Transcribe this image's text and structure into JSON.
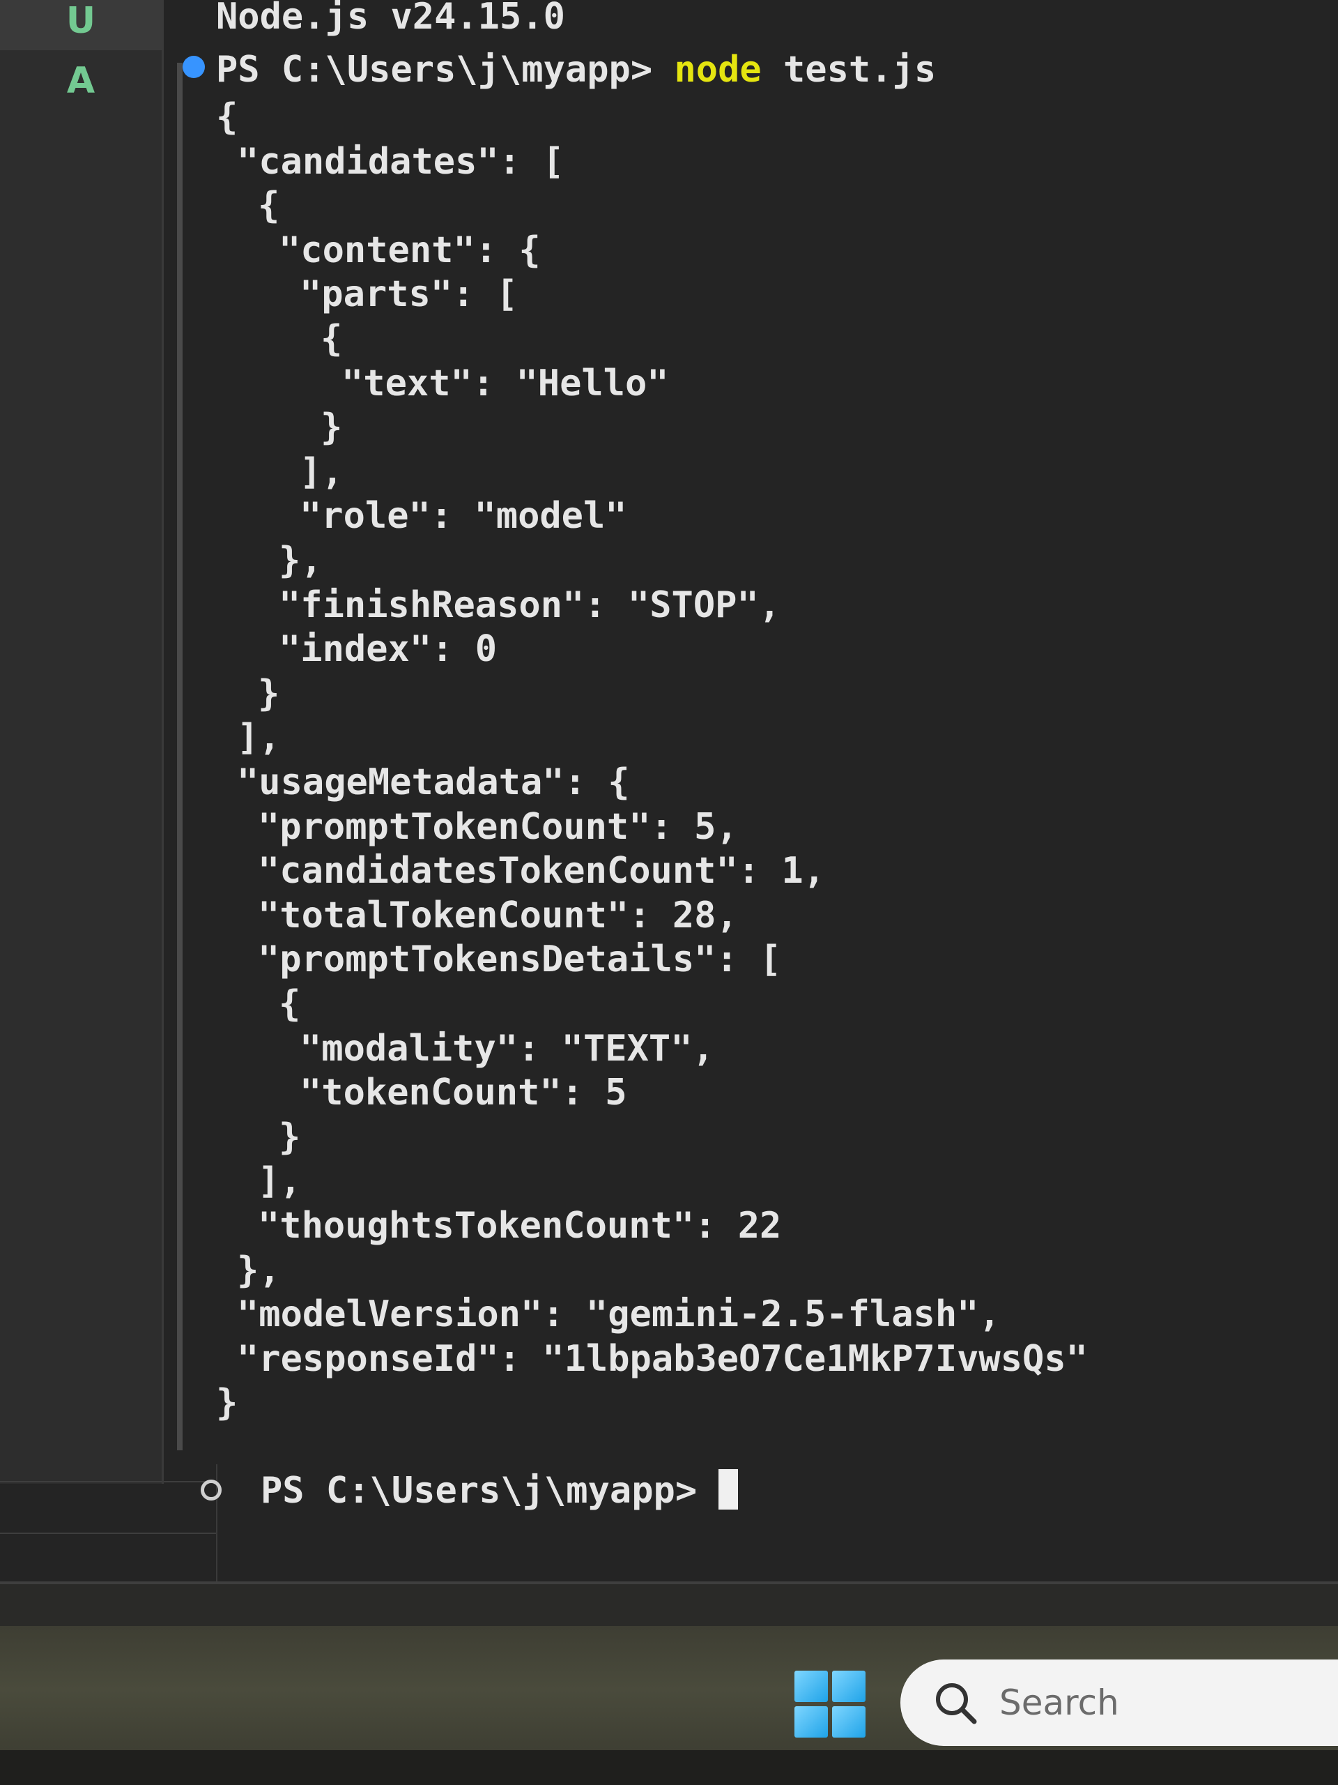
{
  "scm_gutter": {
    "badges": [
      "U",
      "A"
    ]
  },
  "terminal": {
    "header_line": "Node.js v24.15.0",
    "command_line": {
      "prompt": "PS C:\\Users\\j\\myapp> ",
      "command": "node",
      "args": " test.js"
    },
    "output_lines": [
      "{",
      "  \"candidates\": [",
      "    {",
      "      \"content\": {",
      "        \"parts\": [",
      "          {",
      "            \"text\": \"Hello\"",
      "          }",
      "        ],",
      "        \"role\": \"model\"",
      "      },",
      "      \"finishReason\": \"STOP\",",
      "      \"index\": 0",
      "    }",
      "  ],",
      "  \"usageMetadata\": {",
      "    \"promptTokenCount\": 5,",
      "    \"candidatesTokenCount\": 1,",
      "    \"totalTokenCount\": 28,",
      "    \"promptTokensDetails\": [",
      "      {",
      "        \"modality\": \"TEXT\",",
      "        \"tokenCount\": 5",
      "      }",
      "    ],",
      "    \"thoughtsTokenCount\": 22",
      "  },",
      "  \"modelVersion\": \"gemini-2.5-flash\",",
      "  \"responseId\": \"1lbpab3eO7Ce1MkP7IvwsQs\"",
      "}"
    ],
    "current_prompt": "PS C:\\Users\\j\\myapp> "
  },
  "taskbar": {
    "search_placeholder": "Search"
  },
  "colors": {
    "prompt_success_dot": "#3794ff",
    "command_highlight": "#e5e510",
    "scm_badge": "#73c991"
  },
  "icons": {
    "start": "windows-start-icon",
    "search": "search-icon"
  }
}
